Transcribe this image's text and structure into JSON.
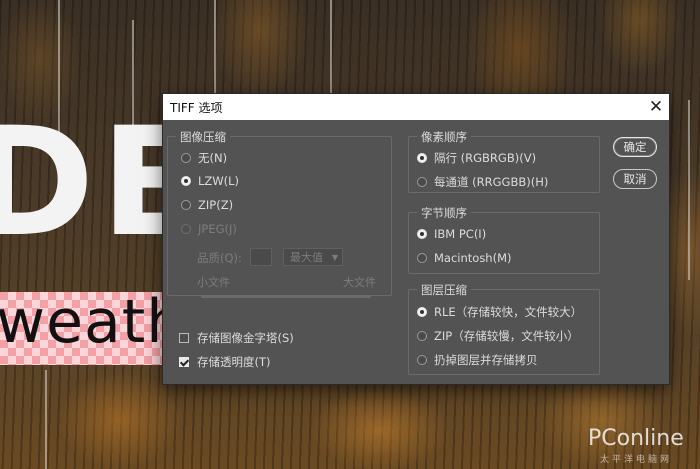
{
  "background": {
    "big_text": "DE",
    "layer_word": "weath",
    "watermark": "PConline",
    "watermark_sub": "太平洋电脑网"
  },
  "dialog": {
    "title": "TIFF 选项",
    "close_icon": "close-icon",
    "image_compression": {
      "legend": "图像压缩",
      "options": [
        "无(N)",
        "LZW(L)",
        "ZIP(Z)",
        "JPEG(J)"
      ],
      "selected": "LZW(L)",
      "quality_label": "品质(Q):",
      "quality_value": "",
      "quality_select": "最大值",
      "small_file": "小文件",
      "large_file": "大文件"
    },
    "pixel_order": {
      "legend": "像素顺序",
      "options": [
        "隔行 (RGBRGB)(V)",
        "每通道 (RRGGBB)(H)"
      ],
      "selected": "隔行 (RGBRGB)(V)"
    },
    "byte_order": {
      "legend": "字节顺序",
      "options": [
        "IBM PC(I)",
        "Macintosh(M)"
      ],
      "selected": "IBM PC(I)"
    },
    "layer_compression": {
      "legend": "图层压缩",
      "options": [
        "RLE（存储较快，文件较大）",
        "ZIP（存储较慢，文件较小）",
        "扔掉图层并存储拷贝"
      ],
      "selected": "RLE（存储较快，文件较大）"
    },
    "checkboxes": [
      {
        "label": "存储图像金字塔(S)",
        "checked": false
      },
      {
        "label": "存储透明度(T)",
        "checked": true
      }
    ],
    "buttons": {
      "ok": "确定",
      "cancel": "取消"
    }
  }
}
